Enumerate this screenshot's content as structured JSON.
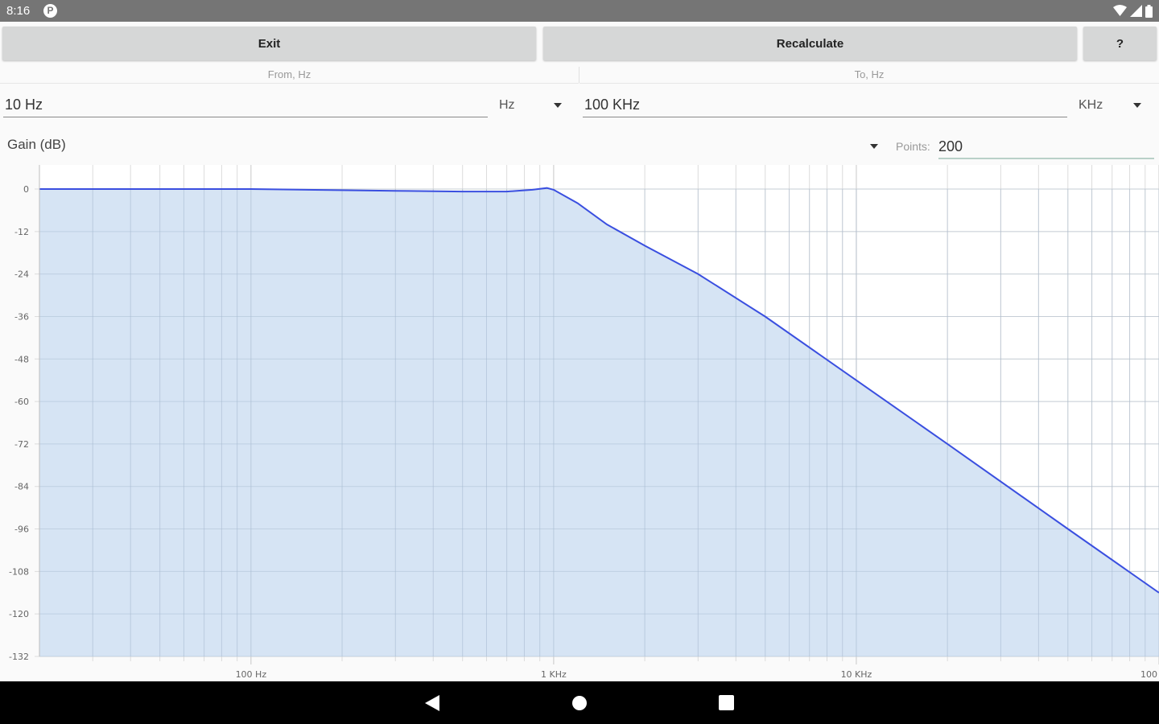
{
  "status_bar": {
    "time": "8:16",
    "app_icon": "P"
  },
  "toolbar": {
    "exit_label": "Exit",
    "recalculate_label": "Recalculate",
    "help_label": "?"
  },
  "range": {
    "from_label": "From, Hz",
    "to_label": "To, Hz",
    "from_value": "10 Hz",
    "from_unit": "Hz",
    "to_value": "100 KHz",
    "to_unit": "KHz"
  },
  "plot_options": {
    "mode": "Gain (dB)",
    "points_label": "Points:",
    "points_value": "200"
  },
  "chart_data": {
    "type": "area",
    "x_scale": "log",
    "xlim": [
      20,
      100000
    ],
    "ylim": [
      -132,
      0
    ],
    "y_ticks": [
      0,
      -12,
      -24,
      -36,
      -48,
      -60,
      -72,
      -84,
      -96,
      -108,
      -120,
      -132
    ],
    "y_tick_labels": [
      "0",
      "-12",
      "-24",
      "-36",
      "-48",
      "-60",
      "-72",
      "-84",
      "-96",
      "-108",
      "-120",
      "-132"
    ],
    "x_tick_values": [
      100,
      1000,
      10000,
      100000
    ],
    "x_tick_labels": [
      "100 Hz",
      "1 KHz",
      "10 KHz",
      "100"
    ],
    "grid": true,
    "line_color": "#3a4fe0",
    "fill_color": "#cfdff2",
    "series": [
      {
        "x": [
          20,
          100,
          300,
          500,
          700,
          850,
          950,
          1000,
          1200,
          1500,
          2000,
          3000,
          5000,
          10000,
          20000,
          50000,
          100000
        ],
        "values": [
          0,
          0,
          -0.5,
          -0.7,
          -0.7,
          -0.2,
          0.3,
          -0.2,
          -4,
          -10,
          -16,
          -24,
          -36,
          -54,
          -72,
          -96,
          -114
        ]
      }
    ]
  },
  "colors": {
    "status_bar": "#757575",
    "button": "#d6d7d7",
    "nav_bar": "#000000"
  },
  "nav_bar": {
    "icons": [
      "back-icon",
      "home-icon",
      "recents-icon"
    ]
  }
}
